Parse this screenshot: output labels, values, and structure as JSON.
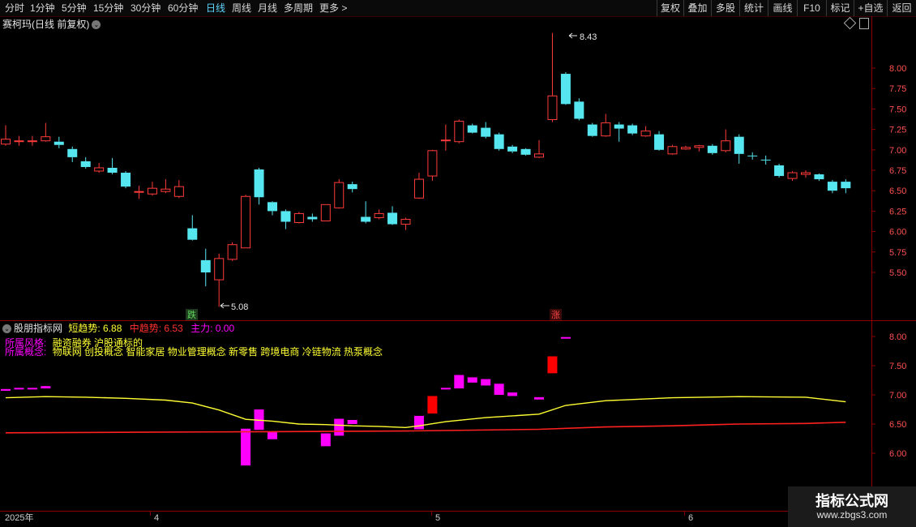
{
  "toolbar": {
    "periods": [
      "分时",
      "1分钟",
      "5分钟",
      "15分钟",
      "30分钟",
      "60分钟",
      "日线",
      "周线",
      "月线",
      "多周期",
      "更多 >"
    ],
    "active_period": "日线",
    "right_buttons": [
      "复权",
      "叠加",
      "多股",
      "统计",
      "画线",
      "F10",
      "标记",
      "+自选",
      "返回"
    ]
  },
  "main_panel": {
    "title": "赛柯玛(日线 前复权)",
    "y_ticks": [
      "8.00",
      "7.75",
      "7.50",
      "7.25",
      "7.00",
      "6.75",
      "6.50",
      "6.25",
      "6.00",
      "5.75",
      "5.50"
    ],
    "high_label": "8.43",
    "low_label": "5.08",
    "signal_down": "跌",
    "signal_up": "涨",
    "colors": {
      "up": "#ff3b3b",
      "down": "#56e6f0",
      "signal_down_text": "#5fd75f",
      "signal_up_text": "#ff4444"
    }
  },
  "indicator_panel": {
    "name": "股朋指标网",
    "short_trend_label": "短趋势: 6.88",
    "mid_trend_label": "中趋势: 6.53",
    "main_force_label": "主力: 0.00",
    "style_label": "所属风格:",
    "style_value": "融资融券 沪股通标的",
    "concept_label": "所属概念:",
    "concept_value": "物联网 创投概念 智能家居 物业管理概念 新零售 跨境电商 冷链物流 热泵概念",
    "y_ticks": [
      "8.00",
      "7.50",
      "7.00",
      "6.50",
      "6.00"
    ],
    "colors": {
      "short": "#ffff33",
      "mid": "#ff2020",
      "main_force": "#ff00ff",
      "red_bar": "#ff0000"
    }
  },
  "time_axis": {
    "labels": [
      "2025年",
      "4",
      "5",
      "6"
    ]
  },
  "watermark": {
    "main": "指标公式网",
    "sub": "www.zbgs3.com"
  },
  "chart_data": {
    "type": "candlestick",
    "candles": [
      {
        "o": 7.07,
        "c": 7.13,
        "h": 7.3,
        "l": 7.05
      },
      {
        "o": 7.1,
        "c": 7.11,
        "h": 7.17,
        "l": 7.05
      },
      {
        "o": 7.1,
        "c": 7.11,
        "h": 7.17,
        "l": 7.05
      },
      {
        "o": 7.11,
        "c": 7.16,
        "h": 7.33,
        "l": 7.1
      },
      {
        "o": 7.1,
        "c": 7.06,
        "h": 7.16,
        "l": 7.02
      },
      {
        "o": 7.01,
        "c": 6.91,
        "h": 7.04,
        "l": 6.85
      },
      {
        "o": 6.86,
        "c": 6.79,
        "h": 6.91,
        "l": 6.77
      },
      {
        "o": 6.74,
        "c": 6.78,
        "h": 6.84,
        "l": 6.72
      },
      {
        "o": 6.78,
        "c": 6.72,
        "h": 6.9,
        "l": 6.7
      },
      {
        "o": 6.72,
        "c": 6.55,
        "h": 6.74,
        "l": 6.53
      },
      {
        "o": 6.48,
        "c": 6.49,
        "h": 6.56,
        "l": 6.4
      },
      {
        "o": 6.46,
        "c": 6.53,
        "h": 6.61,
        "l": 6.44
      },
      {
        "o": 6.49,
        "c": 6.52,
        "h": 6.64,
        "l": 6.47
      },
      {
        "o": 6.43,
        "c": 6.55,
        "h": 6.63,
        "l": 6.41
      },
      {
        "o": 6.04,
        "c": 5.9,
        "h": 6.2,
        "l": 5.89
      },
      {
        "o": 5.65,
        "c": 5.5,
        "h": 5.79,
        "l": 5.33
      },
      {
        "o": 5.41,
        "c": 5.67,
        "h": 5.73,
        "l": 5.08
      },
      {
        "o": 5.66,
        "c": 5.84,
        "h": 5.87,
        "l": 5.64
      },
      {
        "o": 5.8,
        "c": 6.43,
        "h": 6.45,
        "l": 5.8
      },
      {
        "o": 6.76,
        "c": 6.42,
        "h": 6.78,
        "l": 6.33
      },
      {
        "o": 6.36,
        "c": 6.25,
        "h": 6.37,
        "l": 6.2
      },
      {
        "o": 6.25,
        "c": 6.12,
        "h": 6.27,
        "l": 6.03
      },
      {
        "o": 6.11,
        "c": 6.22,
        "h": 6.24,
        "l": 6.1
      },
      {
        "o": 6.18,
        "c": 6.15,
        "h": 6.22,
        "l": 6.12
      },
      {
        "o": 6.13,
        "c": 6.33,
        "h": 6.33,
        "l": 6.13
      },
      {
        "o": 6.29,
        "c": 6.6,
        "h": 6.64,
        "l": 6.28
      },
      {
        "o": 6.58,
        "c": 6.52,
        "h": 6.61,
        "l": 6.48
      },
      {
        "o": 6.18,
        "c": 6.12,
        "h": 6.37,
        "l": 6.1
      },
      {
        "o": 6.17,
        "c": 6.22,
        "h": 6.27,
        "l": 6.15
      },
      {
        "o": 6.23,
        "c": 6.09,
        "h": 6.31,
        "l": 6.08
      },
      {
        "o": 6.09,
        "c": 6.15,
        "h": 6.17,
        "l": 6.02
      },
      {
        "o": 6.41,
        "c": 6.64,
        "h": 6.72,
        "l": 6.4
      },
      {
        "o": 6.68,
        "c": 6.99,
        "h": 7.0,
        "l": 6.62
      },
      {
        "o": 7.11,
        "c": 7.12,
        "h": 7.31,
        "l": 6.99
      },
      {
        "o": 7.1,
        "c": 7.35,
        "h": 7.37,
        "l": 7.08
      },
      {
        "o": 7.3,
        "c": 7.21,
        "h": 7.32,
        "l": 7.2
      },
      {
        "o": 7.27,
        "c": 7.16,
        "h": 7.34,
        "l": 7.14
      },
      {
        "o": 7.19,
        "c": 7.01,
        "h": 7.21,
        "l": 6.99
      },
      {
        "o": 7.04,
        "c": 6.98,
        "h": 7.06,
        "l": 6.96
      },
      {
        "o": 7.01,
        "c": 6.94,
        "h": 7.02,
        "l": 6.93
      },
      {
        "o": 6.91,
        "c": 6.95,
        "h": 7.12,
        "l": 6.9
      },
      {
        "o": 7.37,
        "c": 7.66,
        "h": 8.43,
        "l": 7.34
      },
      {
        "o": 7.93,
        "c": 7.56,
        "h": 7.95,
        "l": 7.55
      },
      {
        "o": 7.59,
        "c": 7.38,
        "h": 7.63,
        "l": 7.36
      },
      {
        "o": 7.31,
        "c": 7.17,
        "h": 7.33,
        "l": 7.16
      },
      {
        "o": 7.17,
        "c": 7.33,
        "h": 7.44,
        "l": 7.16
      },
      {
        "o": 7.31,
        "c": 7.26,
        "h": 7.34,
        "l": 7.1
      },
      {
        "o": 7.3,
        "c": 7.2,
        "h": 7.32,
        "l": 7.18
      },
      {
        "o": 7.17,
        "c": 7.23,
        "h": 7.29,
        "l": 7.16
      },
      {
        "o": 7.19,
        "c": 7.0,
        "h": 7.23,
        "l": 6.99
      },
      {
        "o": 6.95,
        "c": 7.04,
        "h": 7.06,
        "l": 6.94
      },
      {
        "o": 7.01,
        "c": 7.03,
        "h": 7.05,
        "l": 7.0
      },
      {
        "o": 7.03,
        "c": 7.05,
        "h": 7.06,
        "l": 6.98
      },
      {
        "o": 7.05,
        "c": 6.96,
        "h": 7.07,
        "l": 6.94
      },
      {
        "o": 6.99,
        "c": 7.11,
        "h": 7.25,
        "l": 6.97
      },
      {
        "o": 7.16,
        "c": 6.95,
        "h": 7.19,
        "l": 6.83
      },
      {
        "o": 6.93,
        "c": 6.92,
        "h": 6.97,
        "l": 6.88
      },
      {
        "o": 6.88,
        "c": 6.87,
        "h": 6.93,
        "l": 6.82
      },
      {
        "o": 6.81,
        "c": 6.68,
        "h": 6.83,
        "l": 6.66
      },
      {
        "o": 6.65,
        "c": 6.72,
        "h": 6.74,
        "l": 6.62
      },
      {
        "o": 6.7,
        "c": 6.72,
        "h": 6.75,
        "l": 6.66
      },
      {
        "o": 6.7,
        "c": 6.64,
        "h": 6.71,
        "l": 6.62
      },
      {
        "o": 6.61,
        "c": 6.5,
        "h": 6.63,
        "l": 6.47
      },
      {
        "o": 6.61,
        "c": 6.53,
        "h": 6.64,
        "l": 6.47
      }
    ],
    "price_range": [
      5.08,
      8.43
    ],
    "short_trend": [
      [
        0,
        6.95
      ],
      [
        3,
        6.97
      ],
      [
        6,
        6.96
      ],
      [
        9,
        6.94
      ],
      [
        12,
        6.91
      ],
      [
        14,
        6.86
      ],
      [
        16,
        6.74
      ],
      [
        18,
        6.58
      ],
      [
        20,
        6.55
      ],
      [
        22,
        6.5
      ],
      [
        24,
        6.49
      ],
      [
        26,
        6.47
      ],
      [
        28,
        6.46
      ],
      [
        30,
        6.44
      ],
      [
        31,
        6.47
      ],
      [
        33,
        6.54
      ],
      [
        36,
        6.61
      ],
      [
        40,
        6.67
      ],
      [
        42,
        6.82
      ],
      [
        45,
        6.9
      ],
      [
        50,
        6.95
      ],
      [
        55,
        6.97
      ],
      [
        60,
        6.96
      ],
      [
        63,
        6.88
      ]
    ],
    "mid_trend": [
      [
        0,
        6.35
      ],
      [
        10,
        6.36
      ],
      [
        20,
        6.37
      ],
      [
        30,
        6.38
      ],
      [
        40,
        6.41
      ],
      [
        45,
        6.45
      ],
      [
        50,
        6.47
      ],
      [
        55,
        6.5
      ],
      [
        60,
        6.51
      ],
      [
        63,
        6.53
      ]
    ],
    "main_force_bars": [
      {
        "i": 0,
        "top": 7.1,
        "bottom": 7.07,
        "color": "magenta"
      },
      {
        "i": 1,
        "top": 7.12,
        "bottom": 7.1,
        "color": "magenta"
      },
      {
        "i": 2,
        "top": 7.12,
        "bottom": 7.1,
        "color": "magenta"
      },
      {
        "i": 3,
        "top": 7.15,
        "bottom": 7.11,
        "color": "magenta"
      },
      {
        "i": 18,
        "top": 6.42,
        "bottom": 5.79,
        "color": "magenta"
      },
      {
        "i": 19,
        "top": 6.75,
        "bottom": 6.4,
        "color": "magenta"
      },
      {
        "i": 20,
        "top": 6.36,
        "bottom": 6.24,
        "color": "magenta"
      },
      {
        "i": 24,
        "top": 6.34,
        "bottom": 6.12,
        "color": "magenta"
      },
      {
        "i": 25,
        "top": 6.59,
        "bottom": 6.3,
        "color": "magenta"
      },
      {
        "i": 26,
        "top": 6.57,
        "bottom": 6.5,
        "color": "magenta"
      },
      {
        "i": 31,
        "top": 6.64,
        "bottom": 6.41,
        "color": "magenta"
      },
      {
        "i": 32,
        "top": 6.98,
        "bottom": 6.68,
        "color": "red"
      },
      {
        "i": 33,
        "top": 7.12,
        "bottom": 7.1,
        "color": "magenta"
      },
      {
        "i": 34,
        "top": 7.34,
        "bottom": 7.11,
        "color": "magenta"
      },
      {
        "i": 35,
        "top": 7.3,
        "bottom": 7.21,
        "color": "magenta"
      },
      {
        "i": 36,
        "top": 7.27,
        "bottom": 7.16,
        "color": "magenta"
      },
      {
        "i": 37,
        "top": 7.19,
        "bottom": 7.0,
        "color": "magenta"
      },
      {
        "i": 38,
        "top": 7.04,
        "bottom": 6.98,
        "color": "magenta"
      },
      {
        "i": 40,
        "top": 6.96,
        "bottom": 6.92,
        "color": "magenta"
      },
      {
        "i": 41,
        "top": 7.66,
        "bottom": 7.37,
        "color": "red"
      },
      {
        "i": 42,
        "top": 7.99,
        "bottom": 7.97,
        "color": "magenta"
      }
    ]
  }
}
